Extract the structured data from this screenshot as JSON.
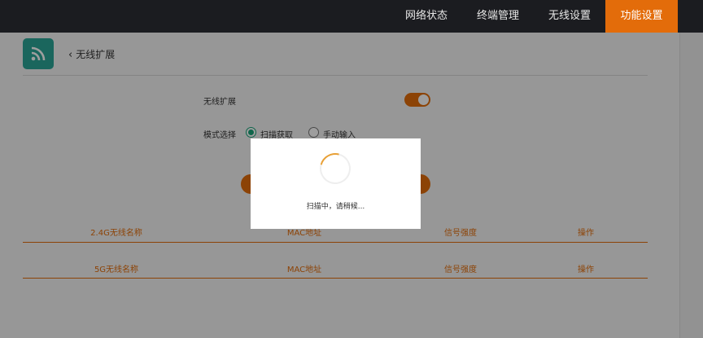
{
  "nav": {
    "items": [
      "网络状态",
      "终端管理",
      "无线设置"
    ],
    "active": "功能设置"
  },
  "header": {
    "back_label": "无线扩展"
  },
  "form": {
    "extend_label": "无线扩展",
    "extend_enabled": true,
    "mode_label": "模式选择",
    "mode_options": [
      "扫描获取",
      "手动输入"
    ],
    "mode_selected": "扫描获取"
  },
  "tables": {
    "t24": {
      "name": "2.4G无线名称",
      "mac": "MAC地址",
      "signal": "信号强度",
      "action": "操作"
    },
    "t5": {
      "name": "5G无线名称",
      "mac": "MAC地址",
      "signal": "信号强度",
      "action": "操作"
    }
  },
  "modal": {
    "text": "扫描中，请稍候..."
  },
  "colors": {
    "accent": "#e36c0a",
    "app_icon": "#2aa596",
    "radio_selected": "#1aa57a",
    "topbar": "#1b1c20"
  }
}
